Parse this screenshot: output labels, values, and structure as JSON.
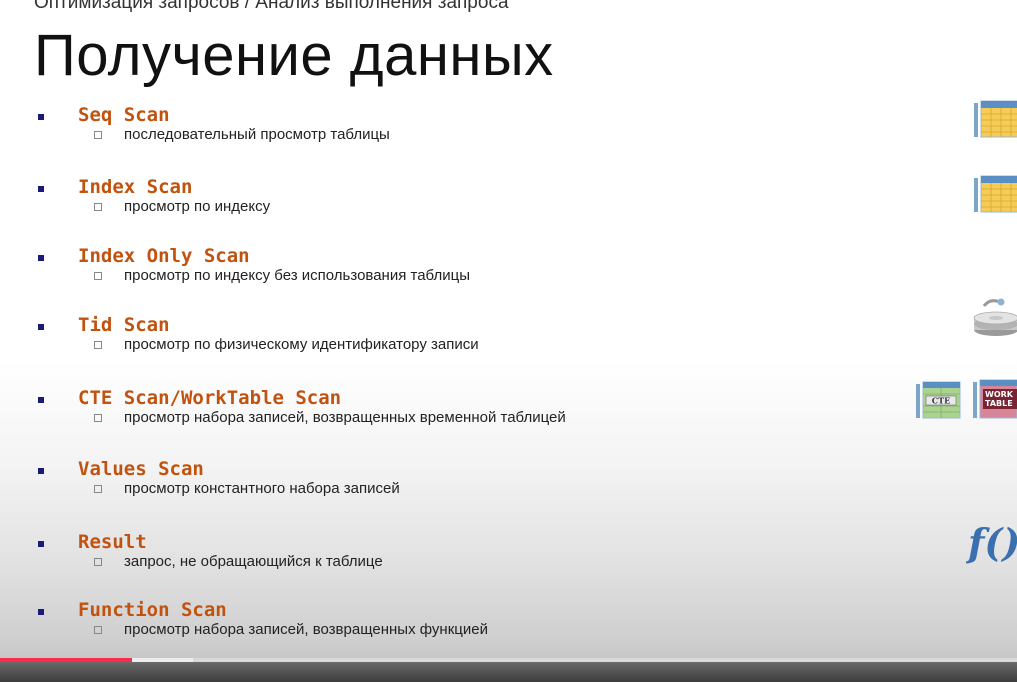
{
  "header": {
    "breadcrumb": "Оптимизация запросов / Анализ выполнения запроса",
    "title": "Получение данных"
  },
  "items": [
    {
      "label": "Seq Scan",
      "description": "последовательный просмотр таблицы"
    },
    {
      "label": "Index Scan",
      "description": "просмотр по индексу"
    },
    {
      "label": "Index Only Scan",
      "description": "просмотр по индексу без использования таблицы"
    },
    {
      "label": "Tid Scan",
      "description": "просмотр по физическому идентификатору записи"
    },
    {
      "label": "CTE Scan/WorkTable Scan",
      "description": "просмотр набора записей, возвращенных временной таблицей"
    },
    {
      "label": "Values Scan",
      "description": "просмотр константного набора записей"
    },
    {
      "label": "Result",
      "description": "запрос, не обращающийся к таблице"
    },
    {
      "label": "Function Scan",
      "description": "просмотр набора записей, возвращенных функцией"
    }
  ],
  "icons": {
    "cte_label": "CTE",
    "worktable_label_1": "WORK",
    "worktable_label_2": "TABLE",
    "function_label": "f()"
  },
  "video": {
    "progress": 0.13,
    "buffered": 0.19
  },
  "colors": {
    "item_label": "#c0530f",
    "bullet": "#1a1a7a",
    "progress": "#ff2b4d"
  }
}
